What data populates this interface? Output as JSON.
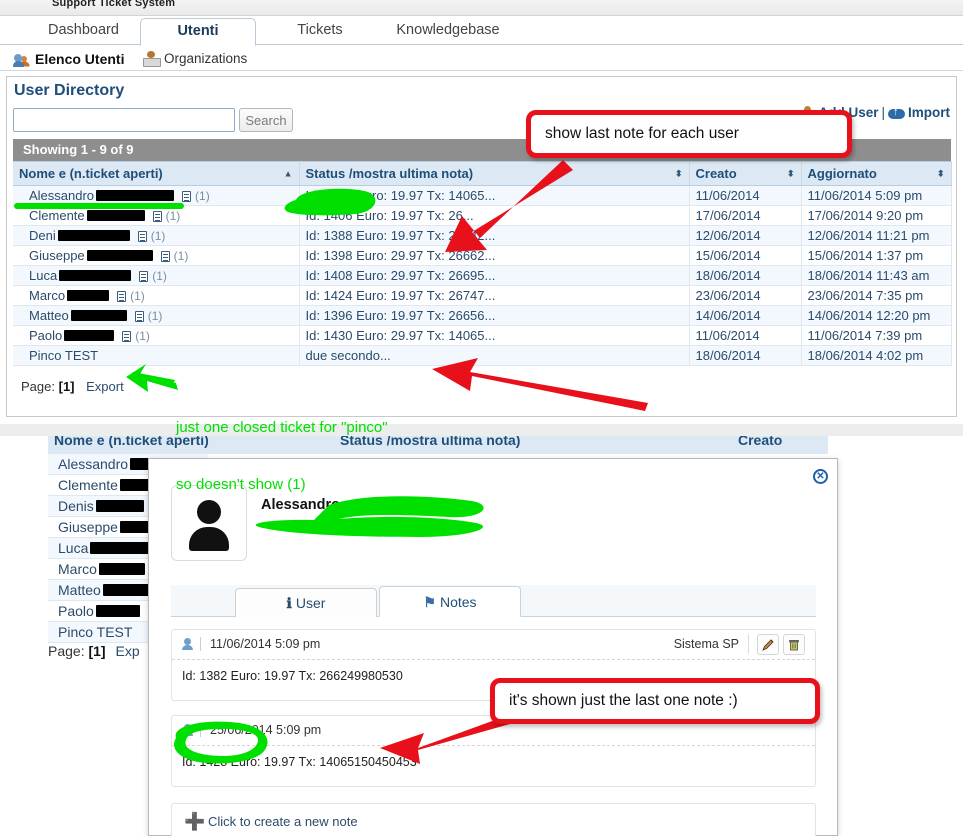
{
  "app": {
    "brand_title": "Support Ticket System"
  },
  "tabs": [
    {
      "label": "Dashboard",
      "active": false
    },
    {
      "label": "Utenti",
      "active": true
    },
    {
      "label": "Tickets",
      "active": false
    },
    {
      "label": "Knowledgebase",
      "active": false
    }
  ],
  "subnav": [
    {
      "label": "Elenco Utenti",
      "icon": "people-icon",
      "active": true
    },
    {
      "label": "Organizations",
      "icon": "organization-icon",
      "active": false
    }
  ],
  "page": {
    "title": "User Directory",
    "search_value": "",
    "search_placeholder": "",
    "search_button": "Search",
    "add_user_label": "Add User",
    "separator": "|",
    "import_label": "Import",
    "showing_label": "Showing",
    "showing_range": "1 - 9 of 9",
    "page_label": "Page:",
    "page_number": "[1]",
    "export_label": "Export"
  },
  "table": {
    "columns": [
      {
        "label": "Nome e (n.ticket aperti)",
        "sort": "asc"
      },
      {
        "label": "Status /mostra ultima nota)",
        "sort": "both"
      },
      {
        "label": "Creato",
        "sort": "both"
      },
      {
        "label": "Aggiornato",
        "sort": "both"
      }
    ],
    "rows": [
      {
        "name": "Alessandro",
        "redact_w": 78,
        "count": "(1)",
        "has_doc": true,
        "status": "Id: 1428 Euro: 19.97 Tx: 14065...",
        "creato": "11/06/2014",
        "aggiornato": "11/06/2014 5:09 pm"
      },
      {
        "name": "Clemente",
        "redact_w": 58,
        "count": "(1)",
        "has_doc": true,
        "status": "Id: 1406 Euro: 19.97 Tx: 26...",
        "creato": "17/06/2014",
        "aggiornato": "17/06/2014 9:20 pm"
      },
      {
        "name": "Deni",
        "redact_w": 72,
        "count": "(1)",
        "has_doc": true,
        "status": "Id: 1388 Euro: 19.97 Tx: 26642...",
        "creato": "12/06/2014",
        "aggiornato": "12/06/2014 11:21 pm"
      },
      {
        "name": "Giuseppe",
        "redact_w": 66,
        "count": "(1)",
        "has_doc": true,
        "status": "Id: 1398 Euro: 29.97 Tx: 26662...",
        "creato": "15/06/2014",
        "aggiornato": "15/06/2014 1:37 pm"
      },
      {
        "name": "Luca",
        "redact_w": 72,
        "count": "(1)",
        "has_doc": true,
        "status": "Id: 1408 Euro: 29.97 Tx: 26695...",
        "creato": "18/06/2014",
        "aggiornato": "18/06/2014 11:43 am"
      },
      {
        "name": "Marco",
        "redact_w": 42,
        "count": "(1)",
        "has_doc": true,
        "status": "Id: 1424 Euro: 19.97 Tx: 26747...",
        "creato": "23/06/2014",
        "aggiornato": "23/06/2014 7:35 pm"
      },
      {
        "name": "Matteo",
        "redact_w": 56,
        "count": "(1)",
        "has_doc": true,
        "status": "Id: 1396 Euro: 19.97 Tx: 26656...",
        "creato": "14/06/2014",
        "aggiornato": "14/06/2014 12:20 pm"
      },
      {
        "name": "Paolo",
        "redact_w": 50,
        "count": "(1)",
        "has_doc": true,
        "status": "Id: 1430 Euro: 29.97 Tx: 14065...",
        "creato": "11/06/2014",
        "aggiornato": "11/06/2014 7:39 pm"
      },
      {
        "name": "Pinco TEST",
        "redact_w": 0,
        "count": "",
        "has_doc": false,
        "status": "due secondo...",
        "creato": "18/06/2014",
        "aggiornato": "18/06/2014 4:02 pm"
      }
    ]
  },
  "lower": {
    "bg_columns": [
      "Nome e (n.ticket aperti)",
      "Status /mostra ultima nota)",
      "Creato"
    ],
    "list": [
      {
        "name": "Alessandro",
        "redact_w": 20
      },
      {
        "name": "Clemente",
        "redact_w": 40
      },
      {
        "name": "Denis",
        "redact_w": 48
      },
      {
        "name": "Giuseppe",
        "redact_w": 30
      },
      {
        "name": "Luca",
        "redact_w": 62
      },
      {
        "name": "Marco",
        "redact_w": 46
      },
      {
        "name": "Matteo",
        "redact_w": 56
      },
      {
        "name": "Paolo",
        "redact_w": 44
      },
      {
        "name": "Pinco TEST",
        "redact_w": 0
      }
    ],
    "page_label": "Page:",
    "page_number": "[1]",
    "export_label": "Exp"
  },
  "modal": {
    "user_name": "Alessandro",
    "close_icon": "close-icon",
    "tabs": [
      {
        "label": "User",
        "icon": "info-icon",
        "active": false
      },
      {
        "label": "Notes",
        "icon": "pin-icon",
        "active": true
      }
    ],
    "notes": [
      {
        "date": "11/06/2014 5:09 pm",
        "author": "Sistema SP",
        "body": "Id: 1382 Euro: 19.97 Tx: 266249980530",
        "show_actions": true
      },
      {
        "date": "25/06/2014 5:09 pm",
        "author": "",
        "body": "Id: 1428 Euro: 19.97 Tx: 14065150450453",
        "show_actions": false
      }
    ],
    "new_note_label": "Click to create a new note"
  },
  "annotations": {
    "callout_top": "show last note for each user",
    "callout_bottom": "it's shown just the last one note :)",
    "green_note_line1": "just one closed ticket for \"pinco\"",
    "green_note_line2": "so doesn't show (1)",
    "colors": {
      "callout_border": "#e8111b",
      "arrow": "#e8111b",
      "highlight": "#00e000"
    }
  }
}
